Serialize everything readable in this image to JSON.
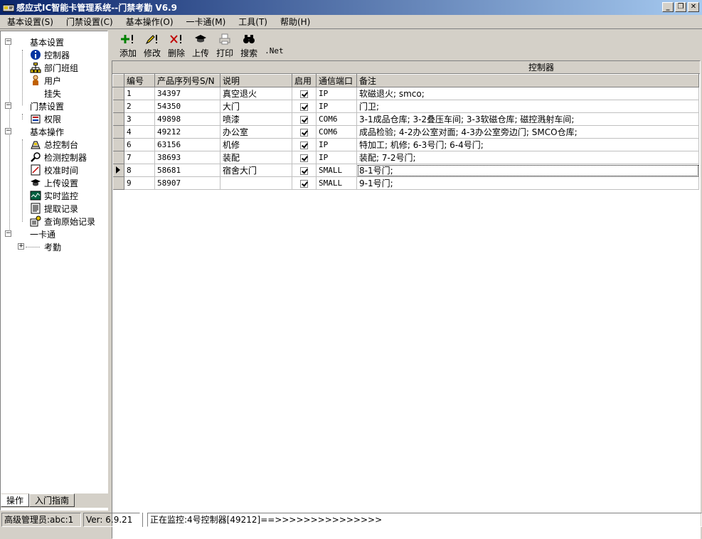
{
  "window": {
    "title": "感应式IC智能卡管理系统--门禁考勤 V6.9",
    "buttons": {
      "minimize": "_",
      "restore": "❐",
      "close": "✕"
    }
  },
  "menu": [
    "基本设置(S)",
    "门禁设置(C)",
    "基本操作(O)",
    "一卡通(M)",
    "工具(T)",
    "帮助(H)"
  ],
  "tree": {
    "basic_settings": {
      "label": "基本设置",
      "items": [
        "控制器",
        "部门班组",
        "用户",
        "挂失"
      ]
    },
    "access_settings": {
      "label": "门禁设置",
      "items": [
        "权限"
      ]
    },
    "basic_operations": {
      "label": "基本操作",
      "items": [
        "总控制台",
        "检测控制器",
        "校准时间",
        "上传设置",
        "实时监控",
        "提取记录",
        "查询原始记录"
      ]
    },
    "one_card": {
      "label": "一卡通",
      "items": [
        "考勤"
      ]
    }
  },
  "left_tabs": [
    "操作",
    "入门指南"
  ],
  "toolbar": {
    "add": "添加",
    "edit": "修改",
    "delete": "删除",
    "upload": "上传",
    "print": "打印",
    "search": "搜索",
    "net": ".Net"
  },
  "grid": {
    "caption": "控制器",
    "columns": [
      "编号",
      "产品序列号S/N",
      "说明",
      "启用",
      "通信端口",
      "备注"
    ],
    "rows": [
      {
        "id": "1",
        "sn": "34397",
        "desc": "真空退火",
        "enabled": true,
        "port": "IP",
        "note": "软磁退火;   smco;"
      },
      {
        "id": "2",
        "sn": "54350",
        "desc": "大门",
        "enabled": true,
        "port": "IP",
        "note": "门卫;"
      },
      {
        "id": "3",
        "sn": "49898",
        "desc": "喷漆",
        "enabled": true,
        "port": "COM6",
        "note": "3-1成品仓库;   3-2叠压车间;   3-3软磁仓库;   磁控溅射车间;"
      },
      {
        "id": "4",
        "sn": "49212",
        "desc": "办公室",
        "enabled": true,
        "port": "COM6",
        "note": "成品检验;   4-2办公室对面;   4-3办公室旁边门;   SMCO仓库;"
      },
      {
        "id": "6",
        "sn": "63156",
        "desc": "机修",
        "enabled": true,
        "port": "IP",
        "note": "特加工;   机修;   6-3号门;   6-4号门;"
      },
      {
        "id": "7",
        "sn": "38693",
        "desc": "装配",
        "enabled": true,
        "port": "IP",
        "note": "装配;   7-2号门;"
      },
      {
        "id": "8",
        "sn": "58681",
        "desc": "宿舍大门",
        "enabled": true,
        "port": "SMALL",
        "note": "8-1号门;",
        "selected": true
      },
      {
        "id": "9",
        "sn": "58907",
        "desc": "",
        "enabled": true,
        "port": "SMALL",
        "note": "9-1号门;"
      }
    ]
  },
  "status": {
    "user": "高级管理员:abc:1",
    "version": "Ver: 6.9.21",
    "monitor": "正在监控:4号控制器[49212]==>>>>>>>>>>>>>>>"
  }
}
